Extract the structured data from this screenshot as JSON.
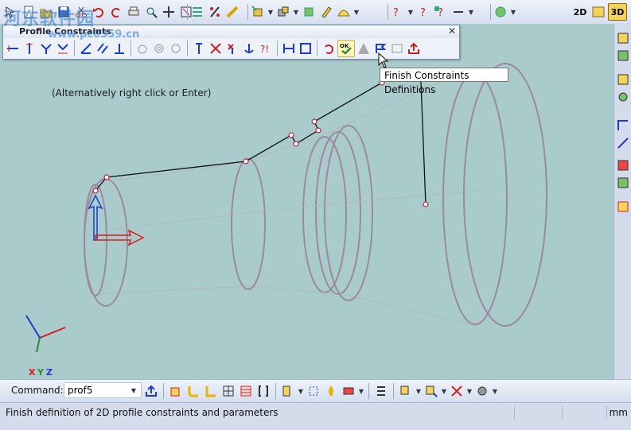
{
  "view_modes": {
    "mode_2d": "2D",
    "mode_3d": "3D"
  },
  "dialog": {
    "title": "Profile Constraints",
    "ok_label": "OK"
  },
  "tooltip": "Finish Constraints Definitions",
  "hint": "(Alternatively right click or Enter)",
  "axes": {
    "x": "X",
    "y": "Y",
    "z": "Z"
  },
  "command": {
    "label": "Command:",
    "value": "prof5"
  },
  "status": {
    "text": "Finish definition of 2D profile constraints and parameters",
    "unit": "mm"
  },
  "watermark": {
    "main": "河东软件园",
    "sub": "www.pc0359.cn"
  },
  "colors": {
    "viewport": "#a9cbcc",
    "profile_line": "#111111",
    "surface": "#9a8aa0",
    "x_axis": "#d21e1e",
    "y_axis": "#2e8b2e",
    "z_axis": "#1e3cc8"
  }
}
